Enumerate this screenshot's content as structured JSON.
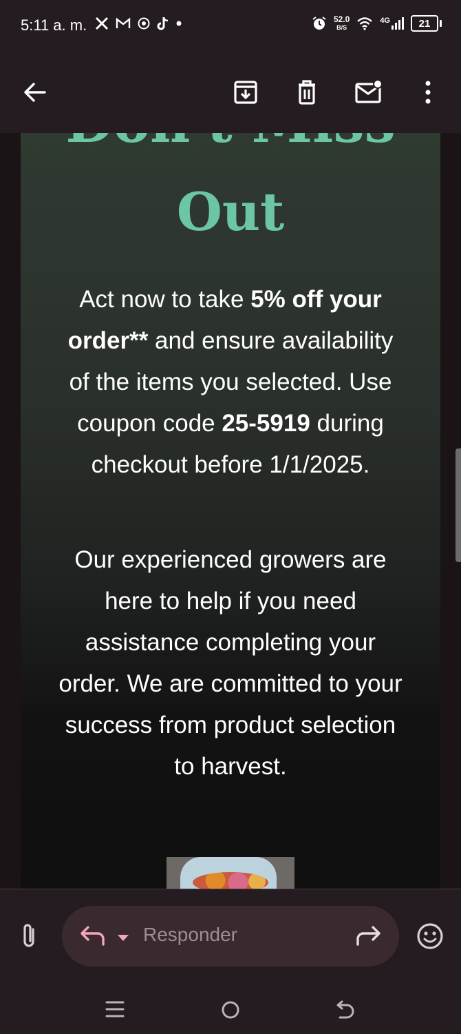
{
  "status_bar": {
    "time": "5:11 a. m.",
    "left_icons": [
      "x-icon",
      "gmail-icon",
      "chrome-icon",
      "tiktok-icon",
      "dot-icon"
    ],
    "speed_value": "52.0",
    "speed_unit": "B/S",
    "network": "4G",
    "battery": "21"
  },
  "toolbar": {
    "icons": [
      "back-arrow-icon",
      "archive-icon",
      "delete-icon",
      "mark-unread-icon",
      "more-vert-icon"
    ]
  },
  "email": {
    "headline_partial": "Don't Miss",
    "headline_out": "Out",
    "para1": {
      "t1": "Act now to take ",
      "b1": "5% off your order**",
      "t2": " and ensure availability of the items you selected. Use coupon code ",
      "b2": "25-5919",
      "t3": " during checkout before 1/1/2025."
    },
    "para2": "Our experienced growers are here to help if you need assistance completing your order. We are committed to your success from product selection to harvest."
  },
  "reply_bar": {
    "placeholder": "Responder",
    "icons": [
      "attach-icon",
      "reply-icon",
      "dropdown-icon",
      "forward-icon",
      "emoji-icon"
    ]
  },
  "colors": {
    "headline": "#6cc6a3",
    "background": "#241c20",
    "reply_pill": "#3a2a30",
    "reply_accent": "#f4a7b9"
  }
}
